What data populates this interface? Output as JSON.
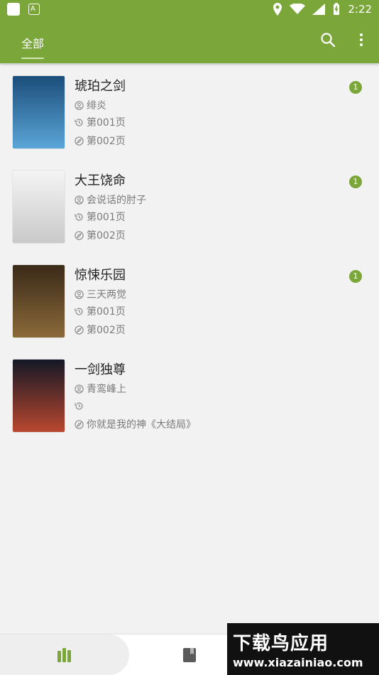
{
  "status_bar": {
    "time": "2:22",
    "left_icons": [
      "notification-square-icon",
      "a-box-icon"
    ],
    "right_icons": [
      "location-icon",
      "wifi-icon",
      "signal-icon",
      "battery-icon"
    ],
    "a_box_text": "A"
  },
  "app_bar": {
    "tab_label": "全部",
    "actions": [
      "search-icon",
      "more-vert-icon"
    ]
  },
  "books": [
    {
      "title": "琥珀之剑",
      "author": "绯炎",
      "last_read": "第001页",
      "latest": "第002页",
      "badge": "1",
      "cover_colors": [
        "#1b4d7a",
        "#5aa6d8"
      ]
    },
    {
      "title": "大王饶命",
      "author": "会说话的肘子",
      "last_read": "第001页",
      "latest": "第002页",
      "badge": "1",
      "cover_colors": [
        "#f4f4f4",
        "#c9c9c9"
      ]
    },
    {
      "title": "惊悚乐园",
      "author": "三天两觉",
      "last_read": "第001页",
      "latest": "第002页",
      "badge": "1",
      "cover_colors": [
        "#3a2a18",
        "#8b6a3a"
      ]
    },
    {
      "title": "一剑独尊",
      "author": "青鸾峰上",
      "last_read": "",
      "latest": "你就是我的神《大结局》",
      "badge": "",
      "cover_colors": [
        "#141826",
        "#b9472f"
      ]
    }
  ],
  "bottom_nav": {
    "items": [
      "bookshelf-icon",
      "book-icon"
    ]
  },
  "watermark": {
    "big": "下载鸟应用",
    "small": "www.xiazainiao.com"
  },
  "colors": {
    "primary": "#7aa63a",
    "badge": "#7aa63a"
  }
}
